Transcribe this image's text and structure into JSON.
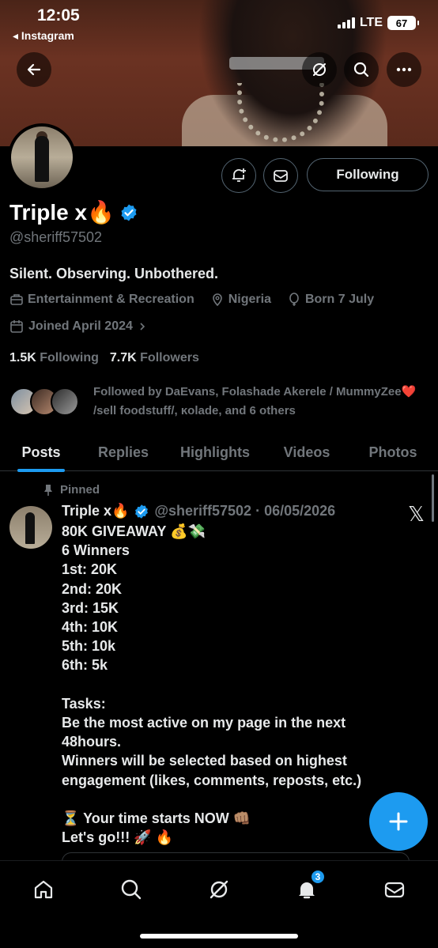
{
  "status_bar": {
    "time": "12:05",
    "back_app": "◂ Instagram",
    "network": "LTE",
    "battery": "67"
  },
  "profile": {
    "name": "Triple x🔥",
    "handle": "@sheriff57502",
    "bio": "Silent. Observing. Unbothered.",
    "category": "Entertainment & Recreation",
    "location": "Nigeria",
    "birthday": "Born 7 July",
    "joined": "Joined April 2024",
    "following_count": "1.5K",
    "following_label": "Following",
    "followers_count": "7.7K",
    "followers_label": "Followers",
    "followed_by": "Followed by DaEvans, Folashade Akerele / MummyZee❤️  /sell foodstuff/, ĸolade, and 6 others",
    "following_button": "Following"
  },
  "tabs": [
    "Posts",
    "Replies",
    "Highlights",
    "Videos",
    "Photos"
  ],
  "active_tab": "Posts",
  "post": {
    "pinned_label": "Pinned",
    "author_name": "Triple x🔥",
    "author_handle_date": "@sheriff57502 · 06/05/2026",
    "lines": [
      "80K GIVEAWAY 💰💸",
      "6 Winners",
      "1st:  20K",
      "2nd: 20K",
      "3rd: 15K",
      "4th: 10K",
      "5th: 10k",
      "6th: 5k",
      "",
      "Tasks:",
      "Be the most active on my page in the next",
      "48hours.",
      "Winners will be selected based on highest",
      "engagement (likes, comments, reposts, etc.)",
      "",
      "⏳ Your time starts NOW 👊🏽",
      "Let's go!!! 🚀 🔥"
    ]
  },
  "nav": {
    "notifications_badge": "3"
  },
  "colors": {
    "accent": "#1d9bf0",
    "muted": "#71767b",
    "text": "#e7e9ea",
    "background": "#000000"
  }
}
